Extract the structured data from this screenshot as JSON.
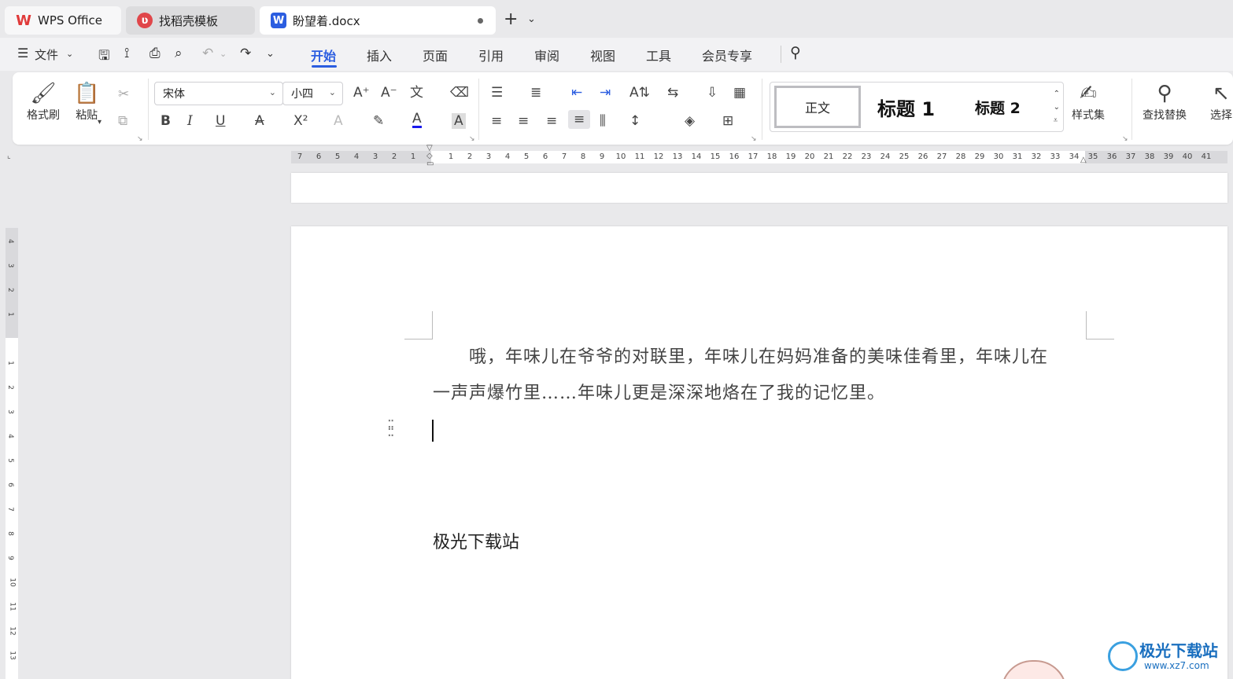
{
  "tabs": {
    "wps": "WPS Office",
    "template": "找稻壳模板",
    "doc": "盼望着.docx",
    "new_tab": "+"
  },
  "menu": {
    "file": "文件",
    "items": [
      "开始",
      "插入",
      "页面",
      "引用",
      "审阅",
      "视图",
      "工具",
      "会员专享"
    ],
    "active": "开始"
  },
  "ribbon": {
    "format_painter": "格式刷",
    "paste": "粘贴",
    "font_name": "宋体",
    "font_size": "小四",
    "styles": {
      "normal": "正文",
      "heading1": "标题 1",
      "heading2": "标题 2"
    },
    "style_set": "样式集",
    "find_replace": "查找替换",
    "select": "选择"
  },
  "ruler": {
    "h_left": [
      "7",
      "6",
      "5",
      "4",
      "3",
      "2",
      "1"
    ],
    "h_right": [
      "1",
      "2",
      "3",
      "4",
      "5",
      "6",
      "7",
      "8",
      "9",
      "10",
      "11",
      "12",
      "13",
      "14",
      "15",
      "16",
      "17",
      "18",
      "19",
      "20",
      "21",
      "22",
      "23",
      "24",
      "25",
      "26",
      "27",
      "28",
      "29",
      "30",
      "31",
      "32",
      "33",
      "34",
      "35",
      "36",
      "37",
      "38",
      "39",
      "40",
      "41"
    ],
    "v_top": [
      "4",
      "3",
      "2",
      "1"
    ],
    "v_bottom": [
      "1",
      "2",
      "3",
      "4",
      "5",
      "6",
      "7",
      "8",
      "9",
      "10",
      "11",
      "12",
      "13"
    ]
  },
  "document": {
    "line1": "　　哦，年味儿在爷爷的对联里，年味儿在妈妈准备的美味佳肴里，年味儿在",
    "line2": "一声声爆竹里……年味儿更是深深地烙在了我的记忆里。",
    "note": "极光下载站"
  },
  "watermark": {
    "title": "极光下载站",
    "url": "www.xz7.com"
  },
  "colors": {
    "accent": "#2b5de0",
    "wps_red": "#e03a3a",
    "word_blue": "#2b5de0"
  }
}
